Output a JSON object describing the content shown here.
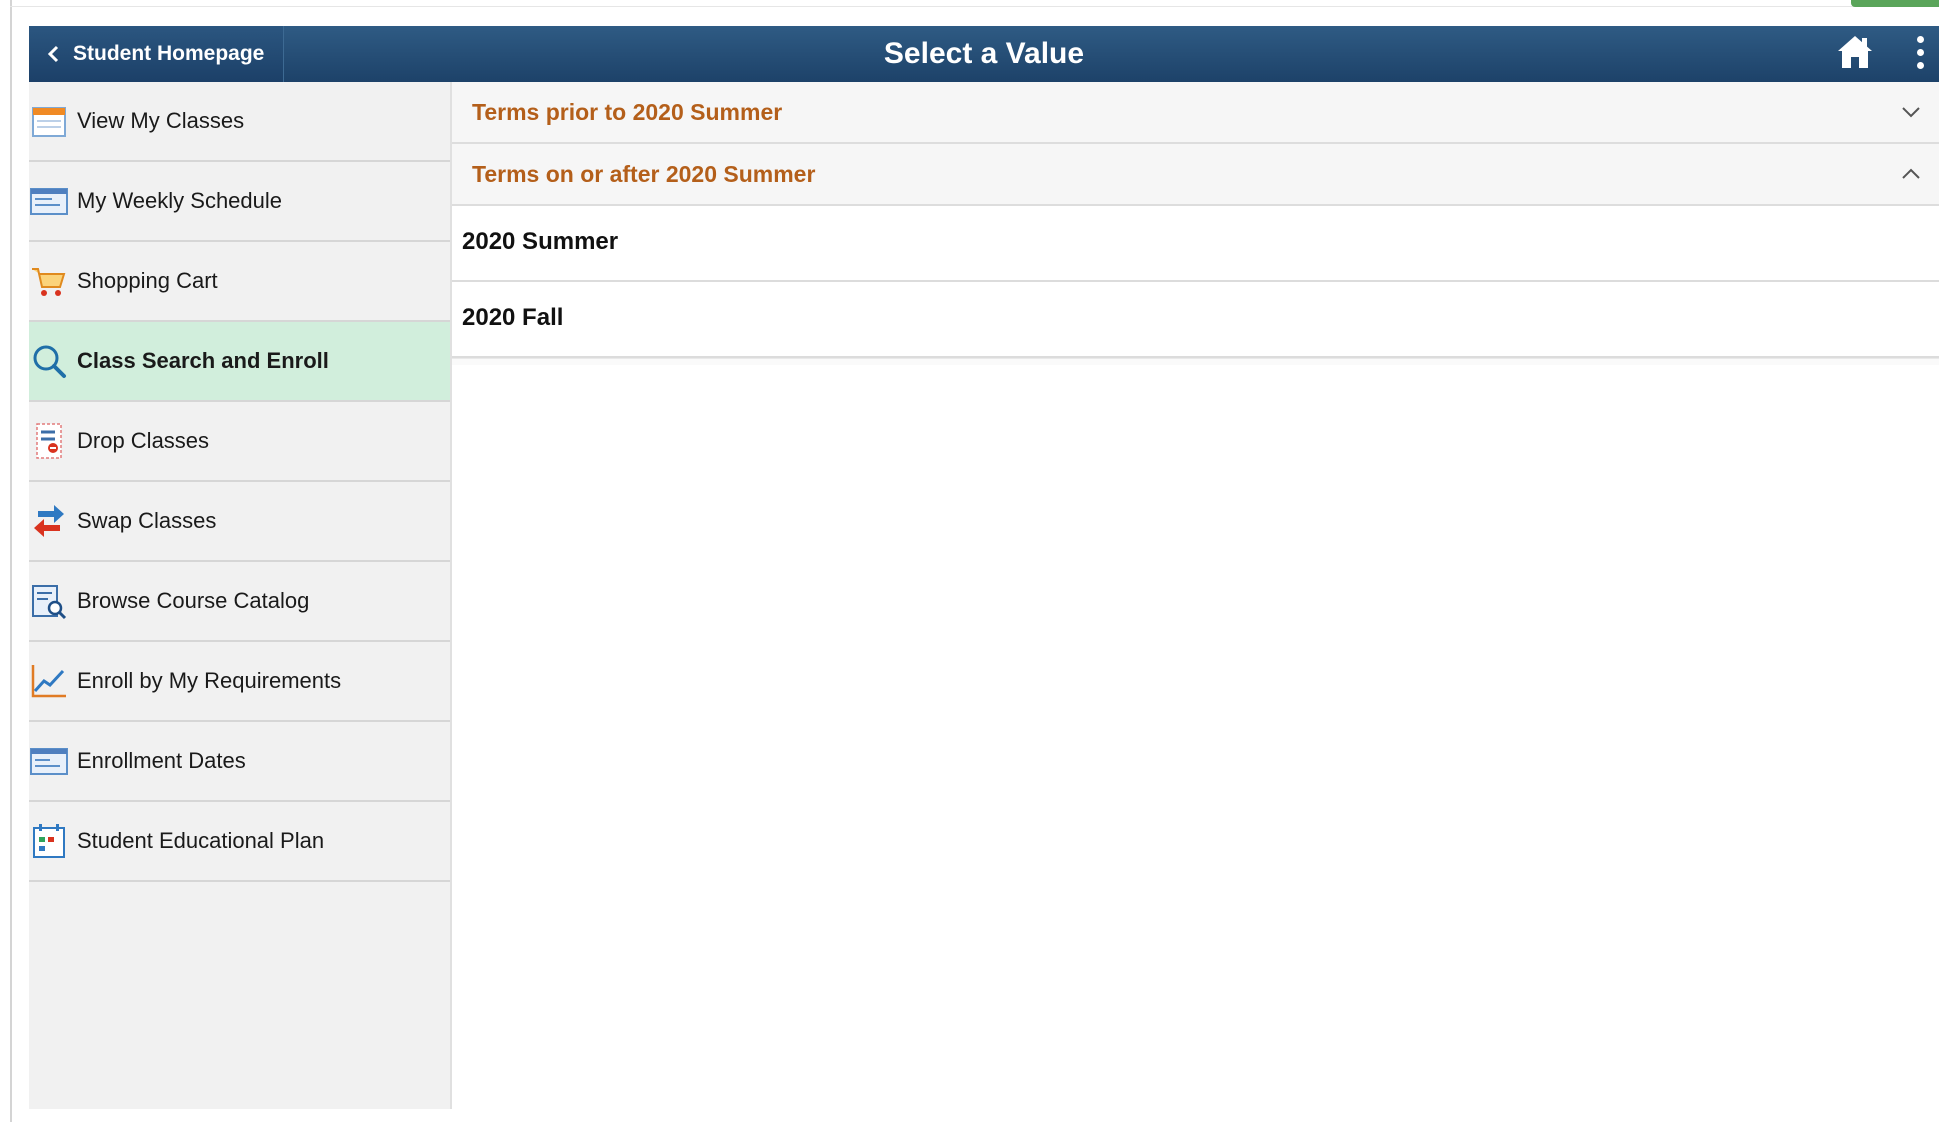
{
  "header": {
    "back_label": "Student Homepage",
    "title": "Select a Value",
    "home_icon": "home-icon",
    "menu_icon": "more-vertical-icon"
  },
  "sidebar": {
    "items": [
      {
        "label": "View My Classes",
        "icon": "calendar-icon",
        "active": false
      },
      {
        "label": "My Weekly Schedule",
        "icon": "schedule-icon",
        "active": false
      },
      {
        "label": "Shopping Cart",
        "icon": "shopping-cart-icon",
        "active": false
      },
      {
        "label": "Class Search and Enroll",
        "icon": "search-icon",
        "active": true
      },
      {
        "label": "Drop Classes",
        "icon": "drop-classes-icon",
        "active": false
      },
      {
        "label": "Swap Classes",
        "icon": "swap-arrows-icon",
        "active": false
      },
      {
        "label": "Browse Course Catalog",
        "icon": "catalog-search-icon",
        "active": false
      },
      {
        "label": "Enroll by My Requirements",
        "icon": "line-chart-icon",
        "active": false
      },
      {
        "label": "Enrollment Dates",
        "icon": "enrollment-dates-icon",
        "active": false
      },
      {
        "label": "Student Educational Plan",
        "icon": "plan-calendar-icon",
        "active": false
      }
    ]
  },
  "groups": [
    {
      "label": "Terms prior to 2020 Summer",
      "expanded": false
    },
    {
      "label": "Terms on or after 2020 Summer",
      "expanded": true,
      "values": [
        "2020 Summer",
        "2020 Fall"
      ]
    }
  ],
  "colors": {
    "header": "#1d4269",
    "active_item": "#d1eedc",
    "group_label": "#b45f1a",
    "sidebar_bg": "#f1f1f1"
  }
}
